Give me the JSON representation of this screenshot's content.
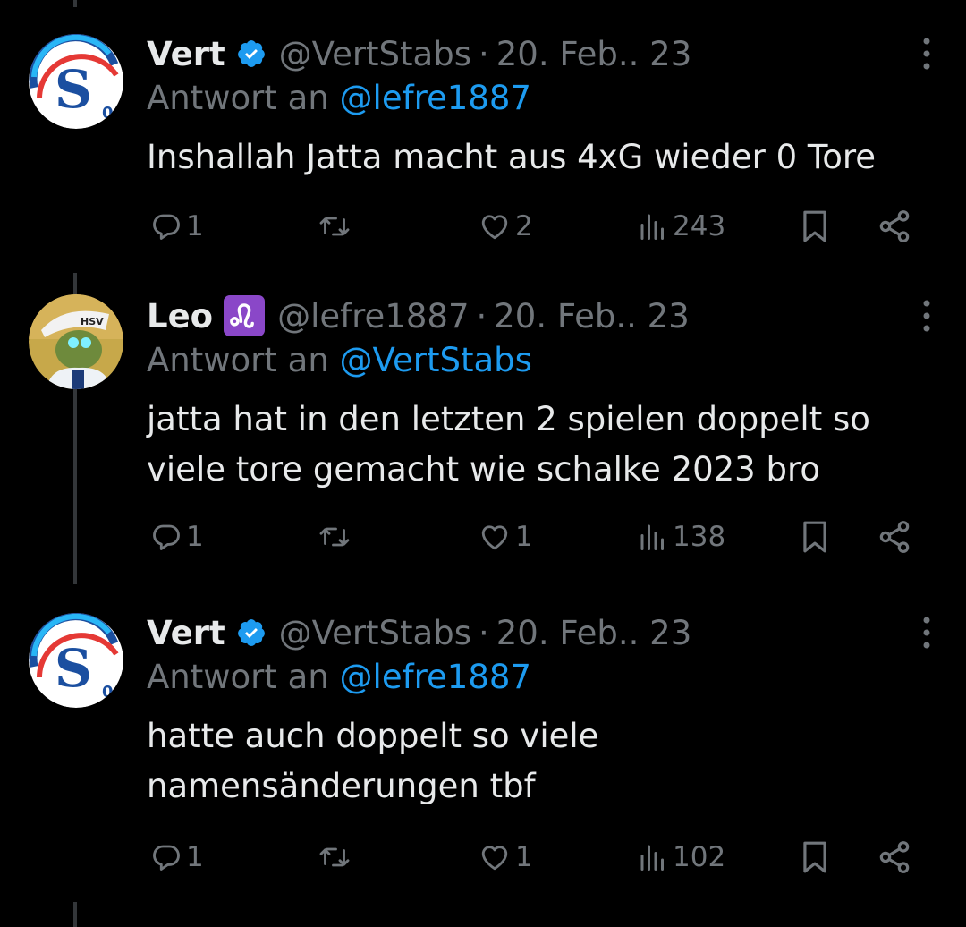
{
  "tweets": [
    {
      "author_name": "Vert",
      "verified": true,
      "handle": "@VertStabs",
      "separator": "·",
      "date": "20. Feb.. 23",
      "reply_prefix": "Antwort an",
      "reply_mention": "@lefre1887",
      "text": "Inshallah Jatta macht aus 4xG wieder 0 Tore",
      "replies": "1",
      "retweets": "",
      "likes": "2",
      "views": "243",
      "avatar": "schalke-logo-avatar"
    },
    {
      "author_name": "Leo",
      "badge_icon": "leo-zodiac-emoji",
      "handle": "@lefre1887",
      "separator": "·",
      "date": "20. Feb.. 23",
      "reply_prefix": "Antwort an",
      "reply_mention": "@VertStabs",
      "text": "jatta hat in den letzten 2 spielen doppelt so viele tore gemacht wie schalke 2023 bro",
      "replies": "1",
      "retweets": "",
      "likes": "1",
      "views": "138",
      "avatar": "hsv-character-avatar"
    },
    {
      "author_name": "Vert",
      "verified": true,
      "handle": "@VertStabs",
      "separator": "·",
      "date": "20. Feb.. 23",
      "reply_prefix": "Antwort an",
      "reply_mention": "@lefre1887",
      "text": "hatte auch doppelt so viele namensänderungen tbf",
      "replies": "1",
      "retweets": "",
      "likes": "1",
      "views": "102",
      "avatar": "schalke-logo-avatar"
    }
  ],
  "colors": {
    "background": "#000000",
    "text_primary": "#e7e9ea",
    "text_secondary": "#71767b",
    "accent": "#1d9bf0",
    "thread_line": "#333639"
  }
}
